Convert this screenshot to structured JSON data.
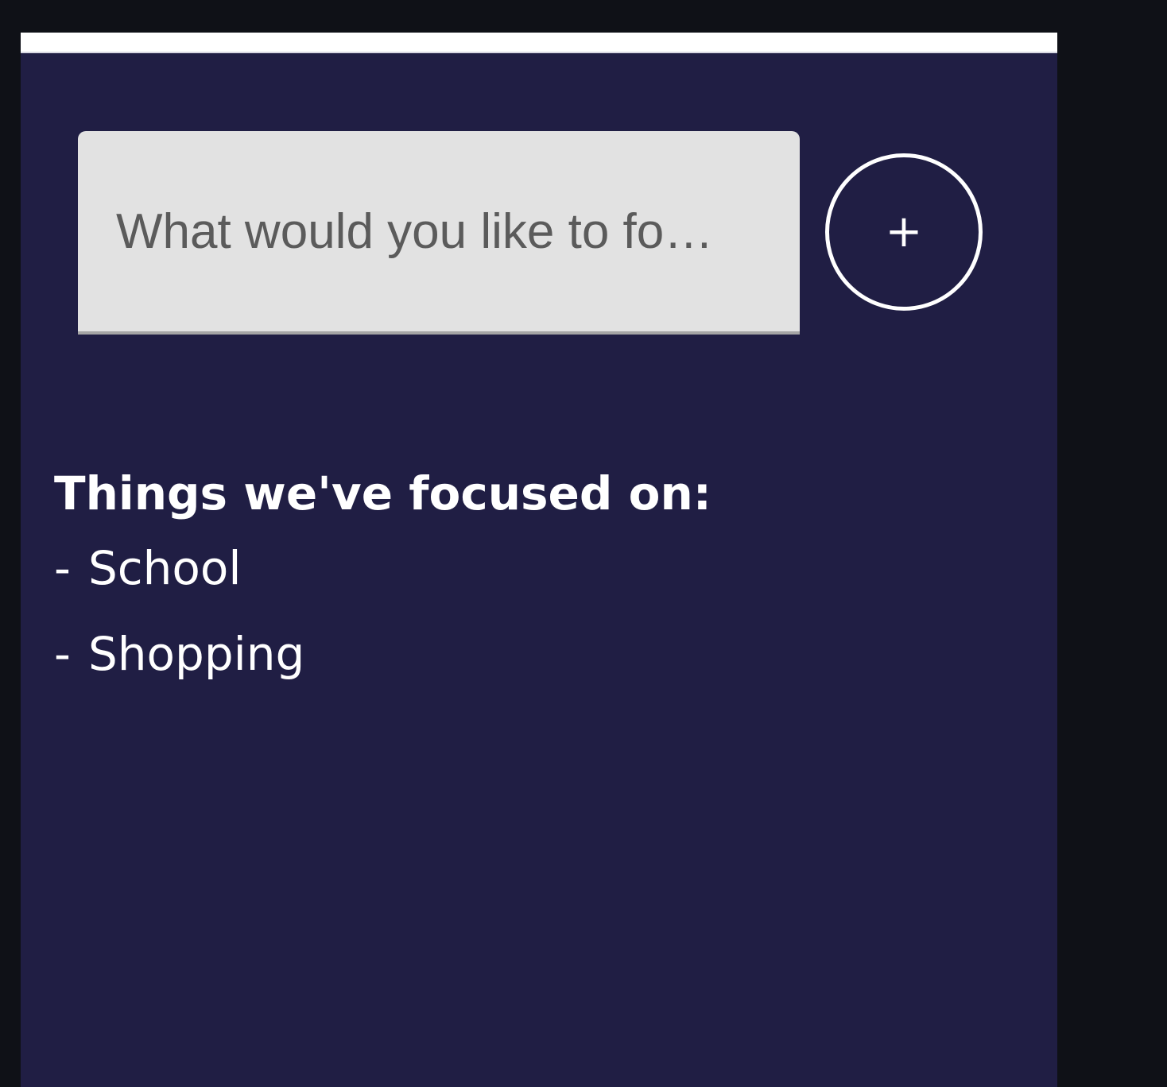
{
  "input": {
    "placeholder": "What would you like to fo…"
  },
  "add_button": {
    "label": "+"
  },
  "focus_list": {
    "heading": "Things we've focused on:",
    "items": [
      {
        "prefix": "-",
        "label": "School"
      },
      {
        "prefix": "-",
        "label": "Shopping"
      }
    ]
  },
  "colors": {
    "page_background": "#0f1117",
    "app_background": "#201e44",
    "input_background": "#e2e2e2",
    "text": "#ffffff"
  }
}
